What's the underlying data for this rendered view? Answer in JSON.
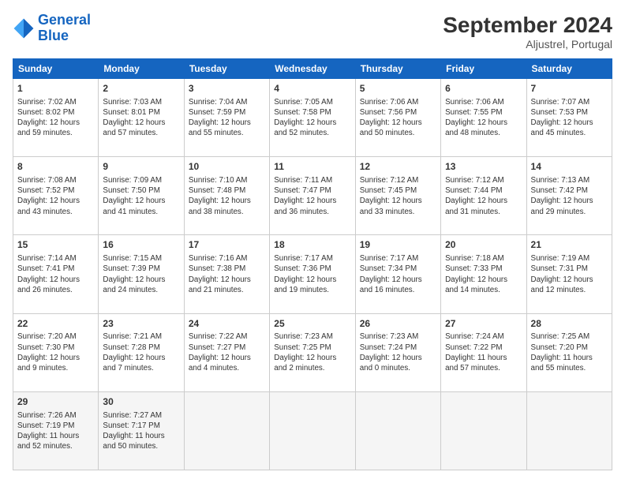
{
  "header": {
    "logo_line1": "General",
    "logo_line2": "Blue",
    "title": "September 2024",
    "subtitle": "Aljustrel, Portugal"
  },
  "columns": [
    "Sunday",
    "Monday",
    "Tuesday",
    "Wednesday",
    "Thursday",
    "Friday",
    "Saturday"
  ],
  "rows": [
    [
      {
        "day": "1",
        "lines": [
          "Sunrise: 7:02 AM",
          "Sunset: 8:02 PM",
          "Daylight: 12 hours",
          "and 59 minutes."
        ]
      },
      {
        "day": "2",
        "lines": [
          "Sunrise: 7:03 AM",
          "Sunset: 8:01 PM",
          "Daylight: 12 hours",
          "and 57 minutes."
        ]
      },
      {
        "day": "3",
        "lines": [
          "Sunrise: 7:04 AM",
          "Sunset: 7:59 PM",
          "Daylight: 12 hours",
          "and 55 minutes."
        ]
      },
      {
        "day": "4",
        "lines": [
          "Sunrise: 7:05 AM",
          "Sunset: 7:58 PM",
          "Daylight: 12 hours",
          "and 52 minutes."
        ]
      },
      {
        "day": "5",
        "lines": [
          "Sunrise: 7:06 AM",
          "Sunset: 7:56 PM",
          "Daylight: 12 hours",
          "and 50 minutes."
        ]
      },
      {
        "day": "6",
        "lines": [
          "Sunrise: 7:06 AM",
          "Sunset: 7:55 PM",
          "Daylight: 12 hours",
          "and 48 minutes."
        ]
      },
      {
        "day": "7",
        "lines": [
          "Sunrise: 7:07 AM",
          "Sunset: 7:53 PM",
          "Daylight: 12 hours",
          "and 45 minutes."
        ]
      }
    ],
    [
      {
        "day": "8",
        "lines": [
          "Sunrise: 7:08 AM",
          "Sunset: 7:52 PM",
          "Daylight: 12 hours",
          "and 43 minutes."
        ]
      },
      {
        "day": "9",
        "lines": [
          "Sunrise: 7:09 AM",
          "Sunset: 7:50 PM",
          "Daylight: 12 hours",
          "and 41 minutes."
        ]
      },
      {
        "day": "10",
        "lines": [
          "Sunrise: 7:10 AM",
          "Sunset: 7:48 PM",
          "Daylight: 12 hours",
          "and 38 minutes."
        ]
      },
      {
        "day": "11",
        "lines": [
          "Sunrise: 7:11 AM",
          "Sunset: 7:47 PM",
          "Daylight: 12 hours",
          "and 36 minutes."
        ]
      },
      {
        "day": "12",
        "lines": [
          "Sunrise: 7:12 AM",
          "Sunset: 7:45 PM",
          "Daylight: 12 hours",
          "and 33 minutes."
        ]
      },
      {
        "day": "13",
        "lines": [
          "Sunrise: 7:12 AM",
          "Sunset: 7:44 PM",
          "Daylight: 12 hours",
          "and 31 minutes."
        ]
      },
      {
        "day": "14",
        "lines": [
          "Sunrise: 7:13 AM",
          "Sunset: 7:42 PM",
          "Daylight: 12 hours",
          "and 29 minutes."
        ]
      }
    ],
    [
      {
        "day": "15",
        "lines": [
          "Sunrise: 7:14 AM",
          "Sunset: 7:41 PM",
          "Daylight: 12 hours",
          "and 26 minutes."
        ]
      },
      {
        "day": "16",
        "lines": [
          "Sunrise: 7:15 AM",
          "Sunset: 7:39 PM",
          "Daylight: 12 hours",
          "and 24 minutes."
        ]
      },
      {
        "day": "17",
        "lines": [
          "Sunrise: 7:16 AM",
          "Sunset: 7:38 PM",
          "Daylight: 12 hours",
          "and 21 minutes."
        ]
      },
      {
        "day": "18",
        "lines": [
          "Sunrise: 7:17 AM",
          "Sunset: 7:36 PM",
          "Daylight: 12 hours",
          "and 19 minutes."
        ]
      },
      {
        "day": "19",
        "lines": [
          "Sunrise: 7:17 AM",
          "Sunset: 7:34 PM",
          "Daylight: 12 hours",
          "and 16 minutes."
        ]
      },
      {
        "day": "20",
        "lines": [
          "Sunrise: 7:18 AM",
          "Sunset: 7:33 PM",
          "Daylight: 12 hours",
          "and 14 minutes."
        ]
      },
      {
        "day": "21",
        "lines": [
          "Sunrise: 7:19 AM",
          "Sunset: 7:31 PM",
          "Daylight: 12 hours",
          "and 12 minutes."
        ]
      }
    ],
    [
      {
        "day": "22",
        "lines": [
          "Sunrise: 7:20 AM",
          "Sunset: 7:30 PM",
          "Daylight: 12 hours",
          "and 9 minutes."
        ]
      },
      {
        "day": "23",
        "lines": [
          "Sunrise: 7:21 AM",
          "Sunset: 7:28 PM",
          "Daylight: 12 hours",
          "and 7 minutes."
        ]
      },
      {
        "day": "24",
        "lines": [
          "Sunrise: 7:22 AM",
          "Sunset: 7:27 PM",
          "Daylight: 12 hours",
          "and 4 minutes."
        ]
      },
      {
        "day": "25",
        "lines": [
          "Sunrise: 7:23 AM",
          "Sunset: 7:25 PM",
          "Daylight: 12 hours",
          "and 2 minutes."
        ]
      },
      {
        "day": "26",
        "lines": [
          "Sunrise: 7:23 AM",
          "Sunset: 7:24 PM",
          "Daylight: 12 hours",
          "and 0 minutes."
        ]
      },
      {
        "day": "27",
        "lines": [
          "Sunrise: 7:24 AM",
          "Sunset: 7:22 PM",
          "Daylight: 11 hours",
          "and 57 minutes."
        ]
      },
      {
        "day": "28",
        "lines": [
          "Sunrise: 7:25 AM",
          "Sunset: 7:20 PM",
          "Daylight: 11 hours",
          "and 55 minutes."
        ]
      }
    ],
    [
      {
        "day": "29",
        "lines": [
          "Sunrise: 7:26 AM",
          "Sunset: 7:19 PM",
          "Daylight: 11 hours",
          "and 52 minutes."
        ]
      },
      {
        "day": "30",
        "lines": [
          "Sunrise: 7:27 AM",
          "Sunset: 7:17 PM",
          "Daylight: 11 hours",
          "and 50 minutes."
        ]
      },
      {
        "day": "",
        "lines": []
      },
      {
        "day": "",
        "lines": []
      },
      {
        "day": "",
        "lines": []
      },
      {
        "day": "",
        "lines": []
      },
      {
        "day": "",
        "lines": []
      }
    ]
  ]
}
